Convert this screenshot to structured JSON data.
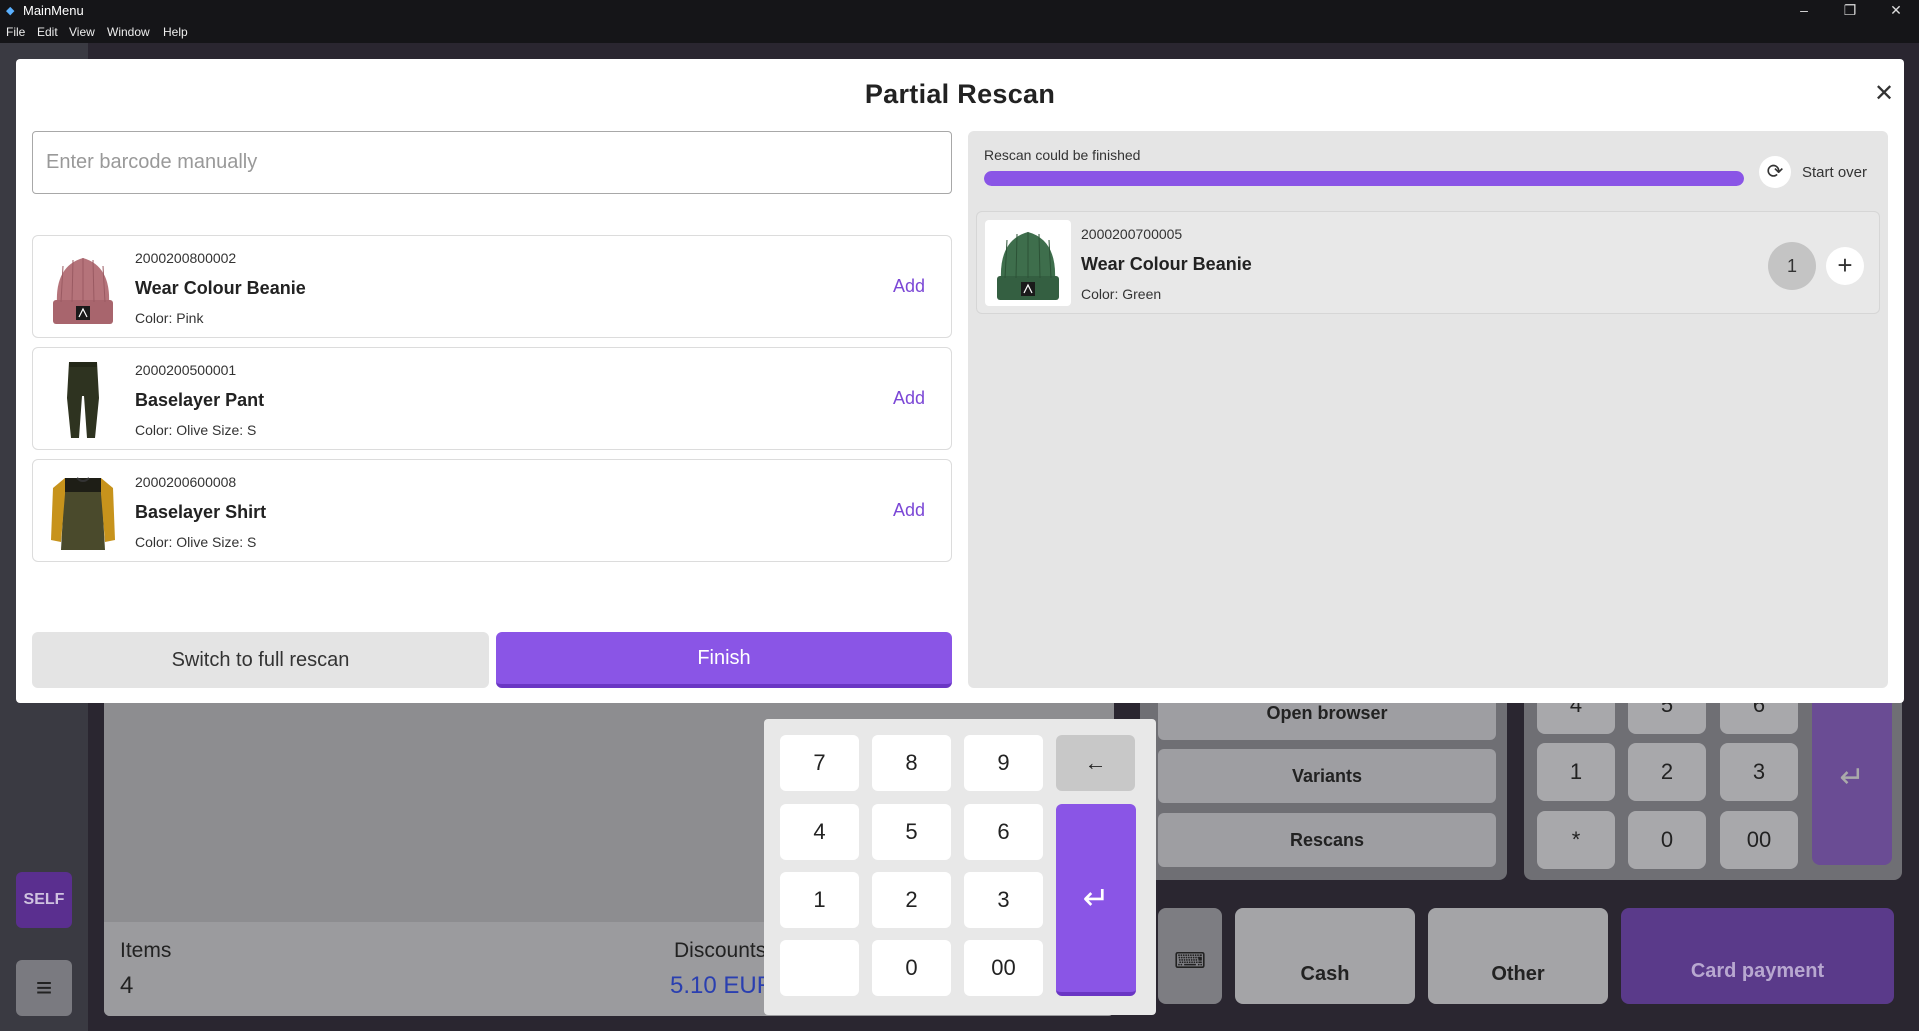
{
  "window": {
    "title": "MainMenu",
    "menu": [
      "File",
      "Edit",
      "View",
      "Window",
      "Help"
    ]
  },
  "modal": {
    "title": "Partial Rescan",
    "barcode_placeholder": "Enter barcode manually",
    "available_items": [
      {
        "barcode": "2000200800002",
        "name": "Wear Colour Beanie",
        "attrs": "Color: Pink",
        "action": "Add",
        "thumb": "pink-beanie"
      },
      {
        "barcode": "2000200500001",
        "name": "Baselayer Pant",
        "attrs": "Color: Olive  Size: S",
        "action": "Add",
        "thumb": "olive-pant"
      },
      {
        "barcode": "2000200600008",
        "name": "Baselayer Shirt",
        "attrs": "Color: Olive  Size: S",
        "action": "Add",
        "thumb": "olive-shirt"
      }
    ],
    "switch_label": "Switch to full rescan",
    "finish_label": "Finish",
    "status_text": "Rescan could be finished",
    "progress": 1.0,
    "start_over_label": "Start over",
    "scanned_items": [
      {
        "barcode": "2000200700005",
        "name": "Wear Colour Beanie",
        "attrs": "Color: Green",
        "qty": "1",
        "thumb": "green-beanie"
      }
    ]
  },
  "numpad": {
    "keys": [
      "7",
      "8",
      "9",
      "4",
      "5",
      "6",
      "1",
      "2",
      "3",
      "",
      "0",
      "00"
    ],
    "backspace_icon": "arrow-left-icon",
    "enter_icon": "enter-icon"
  },
  "background": {
    "left_rail": {
      "self_label": "SELF"
    },
    "footer": {
      "items_label": "Items",
      "items_value": "4",
      "discounts_label": "Discounts",
      "discounts_value": "5.10 EUR"
    },
    "actions": [
      "Open browser",
      "Variants",
      "Rescans"
    ],
    "numpad_keys": [
      "4",
      "5",
      "6",
      "1",
      "2",
      "3",
      "*",
      "0",
      "00"
    ],
    "payments": [
      "Cash",
      "Other",
      "Card payment"
    ]
  },
  "colors": {
    "accent": "#8a55e6",
    "link": "#7b47d6"
  }
}
